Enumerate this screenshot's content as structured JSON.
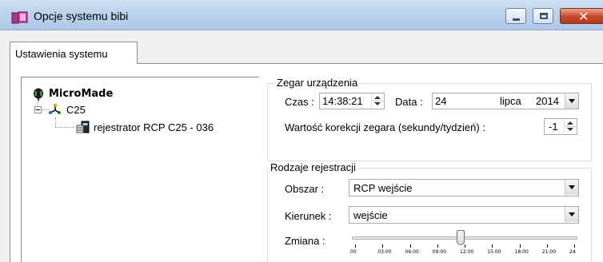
{
  "window": {
    "title": "Opcje systemu bibi",
    "close_symbol": "✕"
  },
  "tabs": [
    {
      "label": "Ustawienia systemu",
      "active": true
    }
  ],
  "tree": {
    "root": {
      "label": "MicroMade",
      "icon": "globe-icon"
    },
    "node": {
      "label": "C25",
      "icon": "network-node-icon"
    },
    "leaf": {
      "label": "rejestrator RCP C25 - 036",
      "icon": "device-recorder-icon"
    }
  },
  "clock": {
    "group_title": "Zegar urządzenia",
    "time_label": "Czas :",
    "time_value": "14:38:21",
    "date_label": "Data :",
    "date_day": "24",
    "date_month": "lipca",
    "date_year": "2014",
    "correction_label": "Wartość korekcji zegara (sekundy/tydzień) :",
    "correction_value": "-1"
  },
  "registration": {
    "group_title": "Rodzaje rejestracji",
    "area_label": "Obszar :",
    "area_value": "RCP wejście",
    "direction_label": "Kierunek :",
    "direction_value": "wejście",
    "shift_label": "Zmiana :",
    "shift_ticks": [
      "00",
      "03:00",
      "06:00",
      "09:00",
      "12:00",
      "15:00",
      "18:00",
      "21:00",
      "24"
    ],
    "shift_value_fraction": 0.48
  },
  "colors": {
    "titlebar": "#bcd3ec",
    "close_button": "#c7462a",
    "app_icon": "#b0328a"
  }
}
